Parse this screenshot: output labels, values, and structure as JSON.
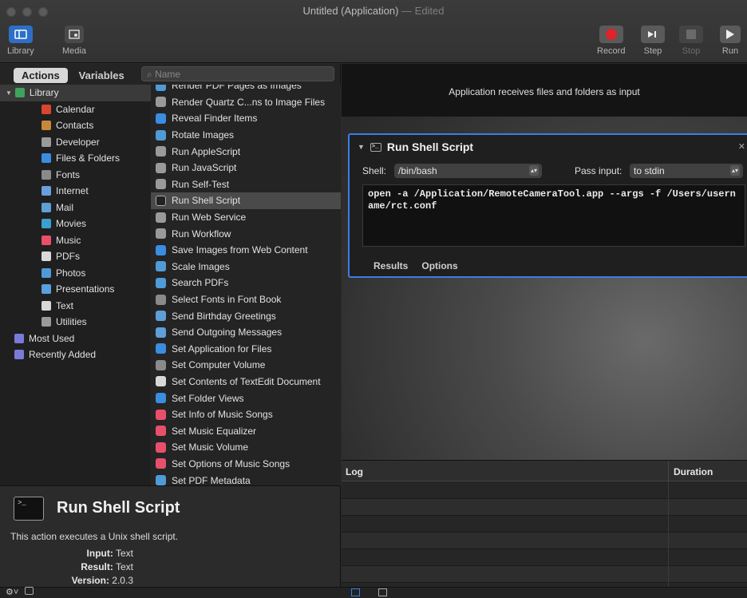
{
  "window": {
    "title": "Untitled (Application)",
    "title_suffix": " — Edited"
  },
  "toolbar": {
    "left": [
      {
        "label": "Library",
        "icon": "library-icon"
      },
      {
        "label": "Media",
        "icon": "media-icon"
      }
    ],
    "right": [
      {
        "label": "Record",
        "icon": "record-icon"
      },
      {
        "label": "Step",
        "icon": "step-icon"
      },
      {
        "label": "Stop",
        "icon": "stop-icon"
      },
      {
        "label": "Run",
        "icon": "run-icon"
      }
    ]
  },
  "library": {
    "tabs": [
      "Actions",
      "Variables"
    ],
    "search_placeholder": "Name",
    "categories": [
      {
        "label": "Library",
        "color": "#3fa35c"
      },
      {
        "label": "Calendar",
        "color": "#d9462f"
      },
      {
        "label": "Contacts",
        "color": "#c8883a"
      },
      {
        "label": "Developer",
        "color": "#9a9a9a"
      },
      {
        "label": "Files & Folders",
        "color": "#3a8de0"
      },
      {
        "label": "Fonts",
        "color": "#8a8a8a"
      },
      {
        "label": "Internet",
        "color": "#6aa0e0"
      },
      {
        "label": "Mail",
        "color": "#5e9fd8"
      },
      {
        "label": "Movies",
        "color": "#3aa0d0"
      },
      {
        "label": "Music",
        "color": "#e8506a"
      },
      {
        "label": "PDFs",
        "color": "#d8d8d8"
      },
      {
        "label": "Photos",
        "color": "#4f9bd8"
      },
      {
        "label": "Presentations",
        "color": "#5aa0e0"
      },
      {
        "label": "Text",
        "color": "#d8d8d8"
      },
      {
        "label": "Utilities",
        "color": "#9a9a9a"
      },
      {
        "label": "Most Used",
        "color": "#7a7ad8"
      },
      {
        "label": "Recently Added",
        "color": "#7a7ad8"
      }
    ],
    "actions": [
      {
        "label": "Render PDF Pages as Images",
        "color": "#4f9bd8"
      },
      {
        "label": "Render Quartz C...ns to Image Files",
        "color": "#9a9a9a"
      },
      {
        "label": "Reveal Finder Items",
        "color": "#3a8de0"
      },
      {
        "label": "Rotate Images",
        "color": "#4f9bd8"
      },
      {
        "label": "Run AppleScript",
        "color": "#9a9a9a"
      },
      {
        "label": "Run JavaScript",
        "color": "#9a9a9a"
      },
      {
        "label": "Run Self-Test",
        "color": "#9a9a9a"
      },
      {
        "label": "Run Shell Script",
        "color": "#222222"
      },
      {
        "label": "Run Web Service",
        "color": "#9a9a9a"
      },
      {
        "label": "Run Workflow",
        "color": "#9a9a9a"
      },
      {
        "label": "Save Images from Web Content",
        "color": "#3a8de0"
      },
      {
        "label": "Scale Images",
        "color": "#4f9bd8"
      },
      {
        "label": "Search PDFs",
        "color": "#4f9bd8"
      },
      {
        "label": "Select Fonts in Font Book",
        "color": "#8a8a8a"
      },
      {
        "label": "Send Birthday Greetings",
        "color": "#5e9fd8"
      },
      {
        "label": "Send Outgoing Messages",
        "color": "#5e9fd8"
      },
      {
        "label": "Set Application for Files",
        "color": "#3a8de0"
      },
      {
        "label": "Set Computer Volume",
        "color": "#8a8a8a"
      },
      {
        "label": "Set Contents of TextEdit Document",
        "color": "#d8d8d8"
      },
      {
        "label": "Set Folder Views",
        "color": "#3a8de0"
      },
      {
        "label": "Set Info of Music Songs",
        "color": "#e8506a"
      },
      {
        "label": "Set Music Equalizer",
        "color": "#e8506a"
      },
      {
        "label": "Set Music Volume",
        "color": "#e8506a"
      },
      {
        "label": "Set Options of Music Songs",
        "color": "#e8506a"
      },
      {
        "label": "Set PDF Metadata",
        "color": "#4f9bd8"
      }
    ]
  },
  "description": {
    "title": "Run Shell Script",
    "text": "This action executes a Unix shell script.",
    "input_label": "Input:",
    "input_value": "Text",
    "result_label": "Result:",
    "result_value": "Text",
    "version_label": "Version:",
    "version_value": "2.0.3"
  },
  "workflow": {
    "header": "Application receives files and folders as input",
    "action": {
      "title": "Run Shell Script",
      "shell_label": "Shell:",
      "shell_value": "/bin/bash",
      "pass_label": "Pass input:",
      "pass_value": "to stdin",
      "script": "open -a /Application/RemoteCameraTool.app --args -f /Users/username/rct.conf",
      "tabs": [
        "Results",
        "Options"
      ]
    }
  },
  "log": {
    "col_log": "Log",
    "col_duration": "Duration"
  }
}
